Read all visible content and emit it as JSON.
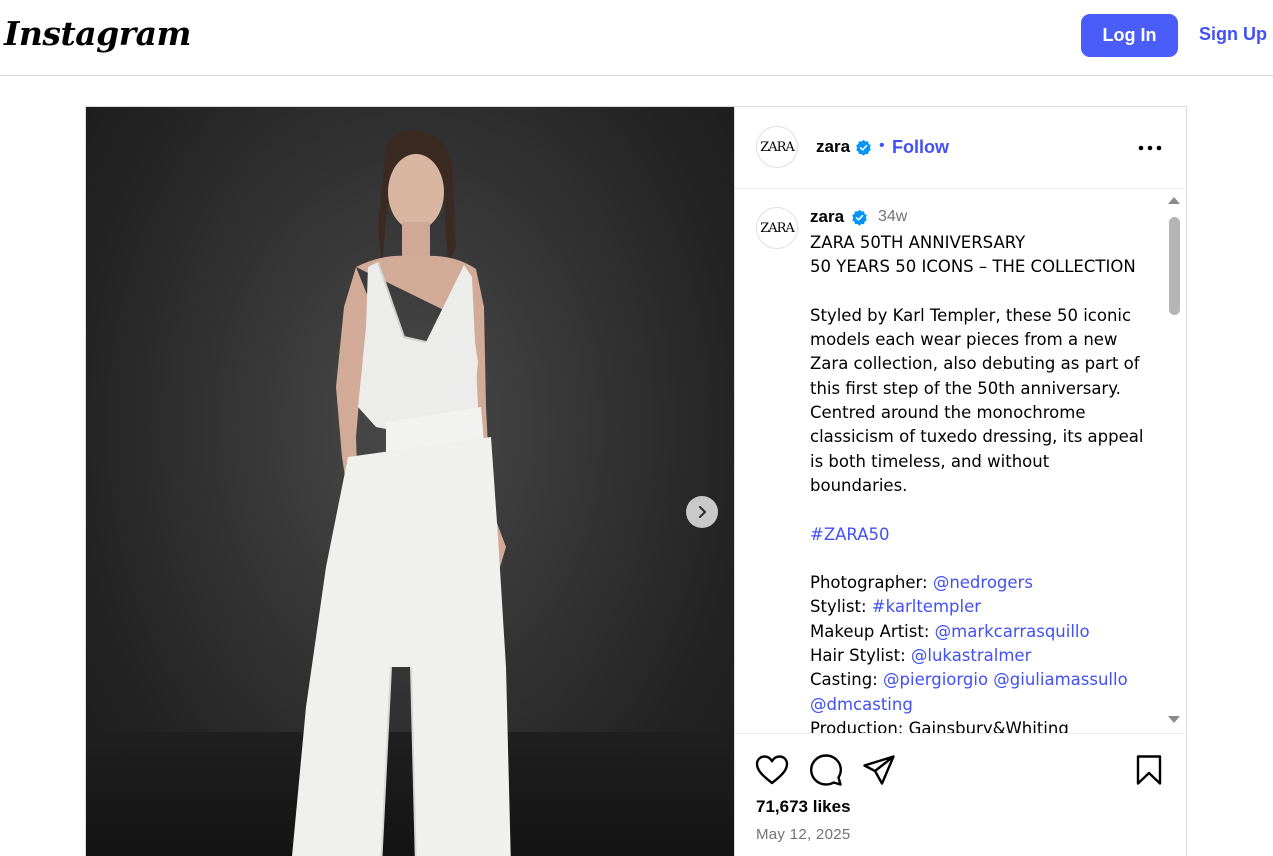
{
  "topbar": {
    "logo": "Instagram",
    "login_label": "Log In",
    "signup_label": "Sign Up"
  },
  "post_header": {
    "avatar_text": "ZARA",
    "username": "zara",
    "separator": "•",
    "follow_label": "Follow"
  },
  "caption": {
    "avatar_text": "ZARA",
    "username": "zara",
    "time": "34w",
    "line1": "ZARA 50TH ANNIVERSARY",
    "line2": "50 YEARS 50 ICONS – THE COLLECTION",
    "body": "Styled by Karl Templer, these 50 iconic models each wear pieces from a new Zara collection, also debuting as part of this first step of the 50th anniversary. Centred around the monochrome classicism of tuxedo dressing, its appeal is both timeless, and without boundaries.",
    "hashtag": "#ZARA50",
    "credits": {
      "photographer_label": "Photographer: ",
      "photographer": "@nedrogers",
      "stylist_label": "Stylist: ",
      "stylist": "#karltempler",
      "makeup_label": "Makeup Artist: ",
      "makeup": "@markcarrasquillo",
      "hair_label": "Hair Stylist: ",
      "hair": "@lukastralmer",
      "casting_label": "Casting: ",
      "casting1": "@piergiorgio",
      "casting2": "@giuliamassullo",
      "casting3": "@dmcasting",
      "production": "Production: Gainsbury&Whiting"
    }
  },
  "stats": {
    "likes": "71,673 likes",
    "date": "May 12, 2025"
  },
  "icons": {
    "like": "heart-icon",
    "comment": "comment-icon",
    "share": "paper-plane-icon",
    "save": "bookmark-icon",
    "more": "ellipsis-icon",
    "next": "chevron-right-icon"
  },
  "colors": {
    "primary": "#4a5df9",
    "link": "#4150f7",
    "verified": "#0095f6",
    "muted": "#737373"
  }
}
